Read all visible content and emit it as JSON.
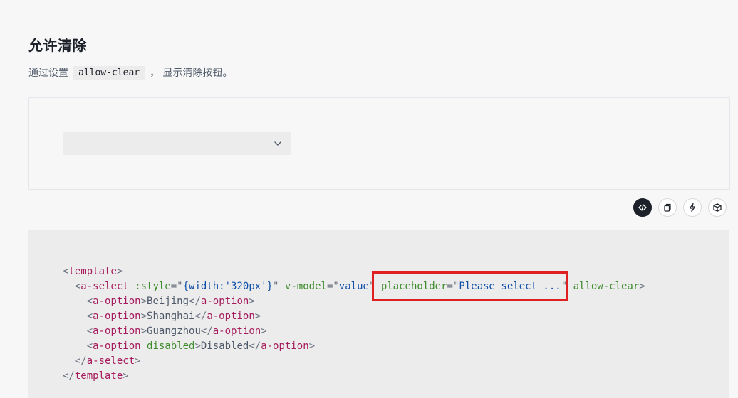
{
  "section": {
    "title": "允许清除",
    "description_prefix": "通过设置",
    "description_code": "allow-clear",
    "description_suffix": "， 显示清除按钮。"
  },
  "demo": {
    "select": {
      "value": "",
      "arrow_icon": "chevron-down-icon"
    }
  },
  "toolbar": {
    "buttons": [
      {
        "name": "code",
        "icon": "code-icon",
        "active": true
      },
      {
        "name": "copy",
        "icon": "copy-icon",
        "active": false
      },
      {
        "name": "playground",
        "icon": "lightning-icon",
        "active": false
      },
      {
        "name": "sandbox",
        "icon": "box-icon",
        "active": false
      }
    ]
  },
  "code": {
    "template_open": "template",
    "select_tag": "a-select",
    "style_attr": ":style",
    "style_value": "{width:'320px'}",
    "vmodel_attr": "v-model",
    "vmodel_value": "value",
    "placeholder_attr": "placeholder",
    "placeholder_value": "Please select ...",
    "allow_clear_attr": "allow-clear",
    "option_tag": "a-option",
    "disabled_attr": "disabled",
    "options": [
      "Beijing",
      "Shanghai",
      "Guangzhou",
      "Disabled"
    ]
  },
  "colors": {
    "highlight": "#e02020",
    "tag": "#a61b5c",
    "attr": "#3d8c2b",
    "string": "#0d4fa8"
  }
}
